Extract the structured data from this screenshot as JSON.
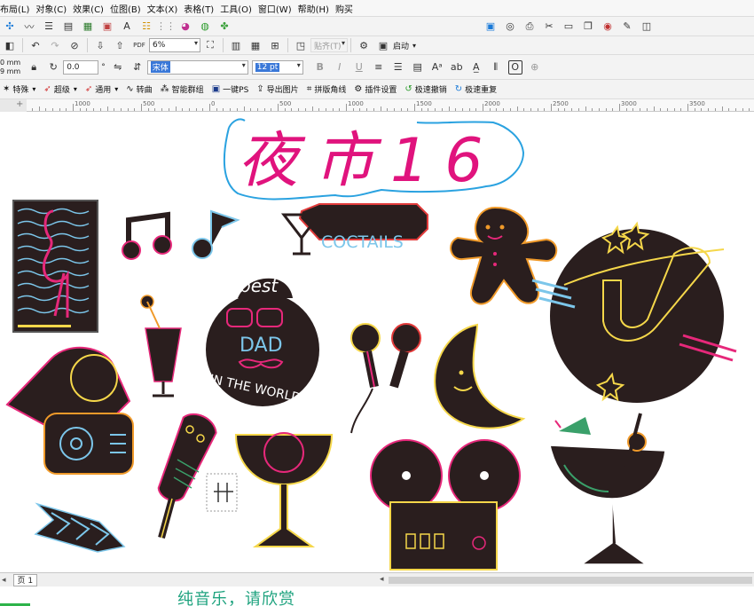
{
  "menubar": {
    "items": [
      "布局(L)",
      "对象(C)",
      "效果(C)",
      "位图(B)",
      "文本(X)",
      "表格(T)",
      "工具(O)",
      "窗口(W)",
      "帮助(H)",
      "购买"
    ]
  },
  "toolbar2": {
    "zoom_value": "6%",
    "snap_label": "贴齐(T)",
    "launch_label": "启动"
  },
  "propbar": {
    "width_value": "0 mm",
    "height_value": "9 mm",
    "rotation_value": "0.0",
    "font_name": "宋体",
    "font_size": "12 pt"
  },
  "pluginbar": {
    "items": [
      {
        "label": "特殊",
        "icon": "star-icon"
      },
      {
        "label": "超级",
        "icon": "rocket-icon"
      },
      {
        "label": "通用",
        "icon": "rocket-icon"
      },
      {
        "label": "转曲",
        "icon": "curve-icon"
      },
      {
        "label": "智能群组",
        "icon": "group-icon"
      },
      {
        "label": "一键PS",
        "icon": "ps-icon"
      },
      {
        "label": "导出图片",
        "icon": "image-export-icon"
      },
      {
        "label": "拼版角线",
        "icon": "corner-marks-icon"
      },
      {
        "label": "插件设置",
        "icon": "gear-icon"
      },
      {
        "label": "极速撤销",
        "icon": "undo-icon"
      },
      {
        "label": "极速重复",
        "icon": "redo-icon"
      }
    ]
  },
  "ruler": {
    "labels": [
      "1500",
      "1000",
      "500",
      "0",
      "500",
      "1000",
      "1500",
      "2000",
      "2500",
      "3000",
      "3500",
      "4000"
    ]
  },
  "canvas": {
    "handwritten_title": "夜市16",
    "coctails_text": "COCTAILS",
    "best_text": "best",
    "dad_text": "DAD",
    "in_the_world_text": "IN THE WORLD"
  },
  "bottombar": {
    "page_tab": "页 1"
  },
  "subtitle": "纯音乐，请欣赏",
  "progress": {
    "fraction": 0.04
  },
  "colors": {
    "neon_pink": "#e6287a",
    "neon_yellow": "#f5d74a",
    "neon_orange": "#f09a2a",
    "neon_blue": "#7cc6ea",
    "neon_red": "#e23b3b",
    "dark_fill": "#2a1e1e",
    "title_magenta": "#e0137d",
    "cloud_blue": "#2aa2e0",
    "subtitle_green": "#1fa37f"
  }
}
